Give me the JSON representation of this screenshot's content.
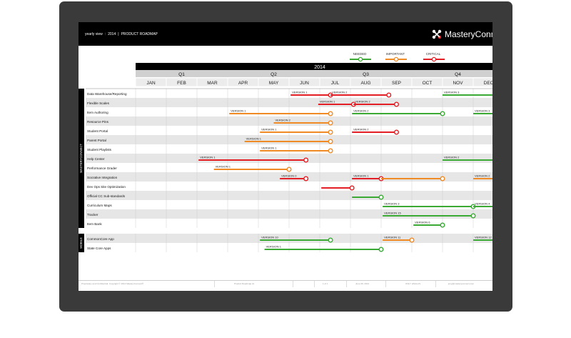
{
  "header": {
    "view": "yearly view",
    "year": "2014",
    "title": "PRODUCT ROADMAP",
    "logo": "MasteryConnect"
  },
  "legend": [
    {
      "label": "NEEDED",
      "color": "#3aaa35"
    },
    {
      "label": "IMPORTANT",
      "color": "#f08a24"
    },
    {
      "label": "CRITICAL",
      "color": "#e31e24"
    }
  ],
  "timeline": {
    "year": "2014",
    "quarters": [
      "Q1",
      "Q2",
      "Q3",
      "Q4"
    ],
    "months": [
      "JAN",
      "FEB",
      "MAR",
      "APR",
      "MAY",
      "JUN",
      "JUL",
      "AUG",
      "SEP",
      "OCT",
      "NOV",
      "DEC"
    ]
  },
  "groups": [
    {
      "label": "MASTERYCONNECT",
      "first": 0,
      "last": 14
    },
    {
      "label": "MOBILE",
      "first": 15,
      "last": 16
    }
  ],
  "rows": [
    {
      "label": "Data Warehouse/Reporting",
      "bars": [
        {
          "text": "VERSION 1",
          "start": 5.05,
          "end": 6.35,
          "color": "red"
        },
        {
          "text": "VERSION 2",
          "start": 6.35,
          "end": 8.25,
          "color": "red"
        },
        {
          "text": "VERSION 3",
          "start": 10.0,
          "end": 12.0,
          "color": "green"
        }
      ]
    },
    {
      "label": "Flexible Scales",
      "bars": [
        {
          "text": "VERSION 1",
          "start": 5.95,
          "end": 7.1,
          "color": "red"
        },
        {
          "text": "VERSION 2",
          "start": 7.1,
          "end": 8.5,
          "color": "red"
        }
      ]
    },
    {
      "label": "Item Authoring",
      "bars": [
        {
          "text": "VERSION 1",
          "start": 3.05,
          "end": 6.35,
          "color": "orange"
        },
        {
          "text": "VERSION 2",
          "start": 7.05,
          "end": 10.0,
          "color": "green"
        },
        {
          "text": "VERSION 3",
          "start": 11.0,
          "end": 12.0,
          "color": "green"
        }
      ]
    },
    {
      "label": "Resource Pins",
      "bars": [
        {
          "text": "VERSION 2",
          "start": 4.5,
          "end": 6.35,
          "color": "orange"
        }
      ]
    },
    {
      "label": "Student Portal",
      "bars": [
        {
          "text": "VERSION 1",
          "start": 4.05,
          "end": 6.35,
          "color": "orange"
        },
        {
          "text": "VERSION 2",
          "start": 7.05,
          "end": 8.5,
          "color": "red"
        }
      ]
    },
    {
      "label": "Parent Portal",
      "bars": [
        {
          "text": "VERSION 1",
          "start": 3.55,
          "end": 6.35,
          "color": "orange"
        }
      ]
    },
    {
      "label": "Student Playlists",
      "bars": [
        {
          "text": "VERSION 1",
          "start": 4.05,
          "end": 6.35,
          "color": "orange"
        }
      ]
    },
    {
      "label": "Help Center",
      "bars": [
        {
          "text": "VERSION 1",
          "start": 2.05,
          "end": 5.55,
          "color": "red"
        },
        {
          "text": "VERSION 2",
          "start": 10.0,
          "end": 12.0,
          "color": "green"
        }
      ]
    },
    {
      "label": "Performance Grader",
      "bars": [
        {
          "text": "VERSION 1",
          "start": 2.55,
          "end": 5.0,
          "color": "orange"
        }
      ]
    },
    {
      "label": "Socrative Integration",
      "bars": [
        {
          "text": "VERSION 0",
          "start": 4.7,
          "end": 5.55,
          "color": "red"
        },
        {
          "text": "VERSION 1",
          "start": 7.05,
          "end": 8.0,
          "color": "red"
        },
        {
          "text": "",
          "start": 8.0,
          "end": 10.0,
          "color": "orange"
        },
        {
          "text": "VERSION 2",
          "start": 11.0,
          "end": 12.0,
          "color": "orange"
        }
      ]
    },
    {
      "label": "Dev Ops Site Optimization",
      "bars": [
        {
          "text": "",
          "start": 6.05,
          "end": 7.05,
          "color": "red"
        }
      ]
    },
    {
      "label": "Official CC Sub-standards",
      "bars": [
        {
          "text": "",
          "start": 7.05,
          "end": 8.0,
          "color": "green"
        }
      ]
    },
    {
      "label": "Curriculum Maps",
      "bars": [
        {
          "text": "VERSION 3",
          "start": 8.05,
          "end": 11.0,
          "color": "green"
        },
        {
          "text": "VERSION 4",
          "start": 11.0,
          "end": 12.0,
          "color": "green"
        }
      ]
    },
    {
      "label": "Tracker",
      "bars": [
        {
          "text": "VERSION 15",
          "start": 8.05,
          "end": 11.0,
          "color": "green"
        }
      ]
    },
    {
      "label": "Item Bank",
      "bars": [
        {
          "text": "VERSION 6",
          "start": 9.05,
          "end": 10.0,
          "color": "green"
        }
      ]
    },
    {
      "label": "CommonCore App",
      "bars": [
        {
          "text": "VERSION 10",
          "start": 4.05,
          "end": 6.35,
          "color": "green"
        },
        {
          "text": "VERSION 11",
          "start": 8.05,
          "end": 9.0,
          "color": "orange"
        },
        {
          "text": "VERSION 12",
          "start": 11.0,
          "end": 12.0,
          "color": "green"
        }
      ]
    },
    {
      "label": "State Core Apps",
      "bars": [
        {
          "text": "VERSION 1",
          "start": 4.2,
          "end": 8.0,
          "color": "green"
        }
      ]
    }
  ],
  "footer": [
    "Proprietary and Confidential. Copyright © 2014 MasteryConnect®",
    "Product Roadmap.txt",
    "1 of 1",
    "June 09, 2014",
    "ONLY HSALLIS",
    "jony@masteryconnect.com"
  ],
  "colors": {
    "red": "#e31e24",
    "orange": "#f08a24",
    "green": "#3aaa35"
  }
}
